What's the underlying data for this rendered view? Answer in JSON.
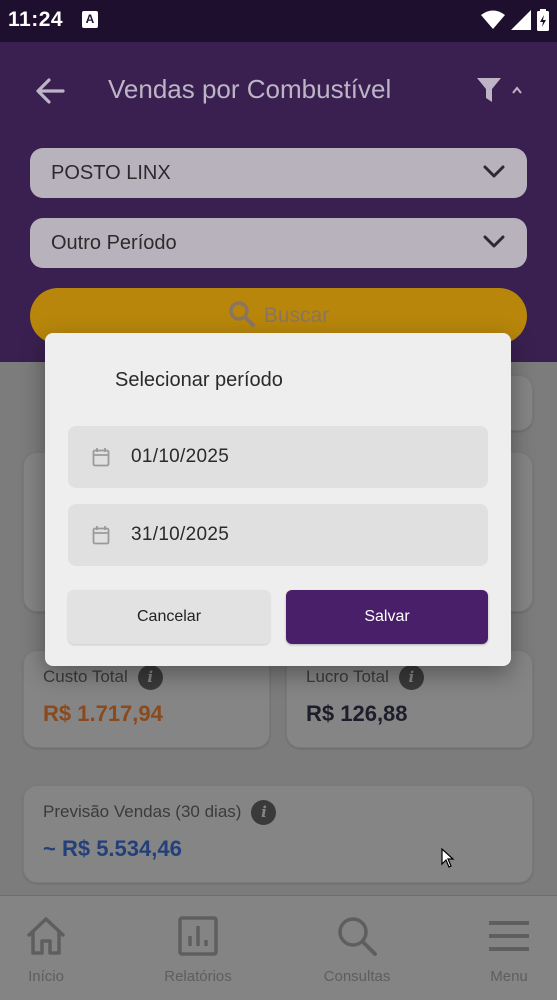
{
  "status_bar": {
    "time": "11:24",
    "notification_icon": "A",
    "icons": [
      "wifi-icon",
      "signal-icon",
      "battery-icon"
    ]
  },
  "header": {
    "title": "Vendas por Combustível",
    "back_icon": "arrow-left-icon",
    "filter_icon": "filter-icon",
    "station_select": "POSTO LINX",
    "period_select": "Outro Período",
    "search_button": "Buscar"
  },
  "cards": {
    "custo_total": {
      "label": "Custo Total",
      "value": "R$ 1.717,94",
      "value_color": "#b34a10"
    },
    "lucro_total": {
      "label": "Lucro Total",
      "value": "R$ 126,88",
      "value_color": "#1d1d2b"
    },
    "previsao_vendas": {
      "label": "Previsão Vendas (30 dias)",
      "value": "~ R$ 5.534,46",
      "value_color": "#1e4c9a"
    }
  },
  "bottom_nav": {
    "items": [
      {
        "label": "Início",
        "icon": "home-icon"
      },
      {
        "label": "Relatórios",
        "icon": "reports-icon"
      },
      {
        "label": "Consultas",
        "icon": "search-icon"
      },
      {
        "label": "Menu",
        "icon": "menu-icon"
      }
    ]
  },
  "dialog": {
    "title": "Selecionar período",
    "start_date": "01/10/2025",
    "end_date": "31/10/2025",
    "cancel_label": "Cancelar",
    "save_label": "Salvar"
  },
  "colors": {
    "header_bg": "#3a2050",
    "accent_yellow": "#b8860b",
    "save_button": "#4a1f6a"
  }
}
